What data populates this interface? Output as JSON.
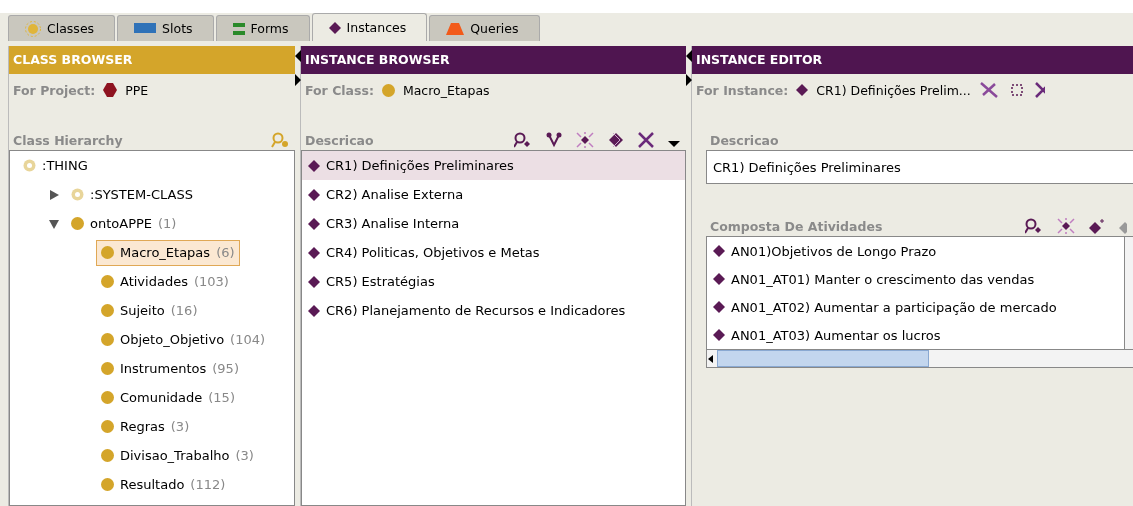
{
  "tabs": [
    {
      "label": "Classes",
      "kind": "classes",
      "selected": false
    },
    {
      "label": "Slots",
      "kind": "slots",
      "selected": false
    },
    {
      "label": "Forms",
      "kind": "forms",
      "selected": false
    },
    {
      "label": "Instances",
      "kind": "instances",
      "selected": true
    },
    {
      "label": "Queries",
      "kind": "queries",
      "selected": false
    }
  ],
  "class_browser": {
    "title": "CLASS BROWSER",
    "project_label": "For Project:",
    "project": "PPE",
    "hierarchy_label": "Class Hierarchy",
    "tree": [
      {
        "name": ":THING",
        "kind": "system",
        "selected": false,
        "children": [
          {
            "name": ":SYSTEM-CLASS",
            "kind": "system",
            "expanded": false,
            "selected": false
          },
          {
            "name": "ontoAPPE",
            "count": "(1)",
            "kind": "user",
            "expanded": true,
            "selected": false,
            "children": [
              {
                "name": "Macro_Etapas",
                "count": "(6)",
                "kind": "user",
                "selected": true
              },
              {
                "name": "Atividades",
                "count": "(103)",
                "kind": "user",
                "selected": false
              },
              {
                "name": "Sujeito",
                "count": "(16)",
                "kind": "user",
                "selected": false
              },
              {
                "name": "Objeto_Objetivo",
                "count": "(104)",
                "kind": "user",
                "selected": false
              },
              {
                "name": "Instrumentos",
                "count": "(95)",
                "kind": "user",
                "selected": false
              },
              {
                "name": "Comunidade",
                "count": "(15)",
                "kind": "user",
                "selected": false
              },
              {
                "name": "Regras",
                "count": "(3)",
                "kind": "user",
                "selected": false
              },
              {
                "name": "Divisao_Trabalho",
                "count": "(3)",
                "kind": "user",
                "selected": false
              },
              {
                "name": "Resultado",
                "count": "(112)",
                "kind": "user",
                "selected": false
              }
            ]
          }
        ]
      }
    ]
  },
  "instance_browser": {
    "title": "INSTANCE BROWSER",
    "class_label": "For Class:",
    "class": "Macro_Etapas",
    "list_label": "Descricao",
    "instances": [
      {
        "label": "CR1) Definições Preliminares",
        "selected": true
      },
      {
        "label": "CR2) Analise Externa",
        "selected": false
      },
      {
        "label": "CR3) Analise Interna",
        "selected": false
      },
      {
        "label": "CR4) Politicas, Objetivos e Metas",
        "selected": false
      },
      {
        "label": "CR5) Estratégias",
        "selected": false
      },
      {
        "label": "CR6) Planejamento de Recursos e Indicadores",
        "selected": false
      }
    ]
  },
  "instance_editor": {
    "title": "INSTANCE EDITOR",
    "instance_label": "For Instance:",
    "instance": "CR1) Definições Prelim...",
    "descricao_label": "Descricao",
    "descricao_value": "CR1) Definições Preliminares",
    "composta_label": "Composta De Atividades",
    "atividades": [
      "AN01)Objetivos de Longo Prazo",
      "AN01_AT01) Manter o crescimento das vendas",
      "AN01_AT02) Aumentar a participação de mercado",
      "AN01_AT03) Aumentar os lucros"
    ]
  }
}
